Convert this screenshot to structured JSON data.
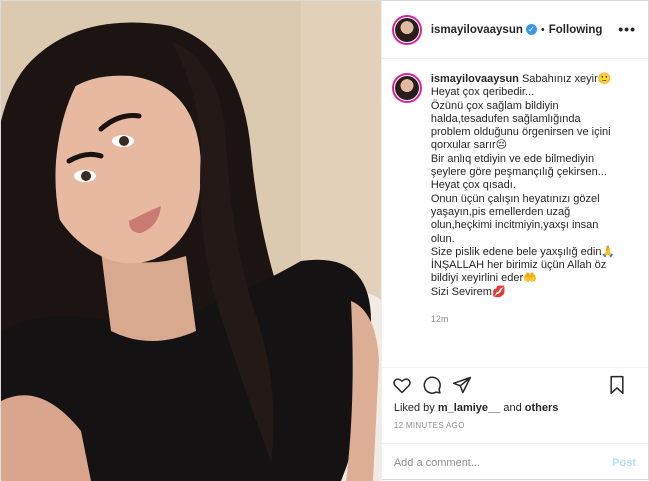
{
  "header": {
    "username": "ismayilovaaysun",
    "dot": "•",
    "following": "Following",
    "more": "•••"
  },
  "caption": {
    "username": "ismayilovaaysun",
    "first_line": "Sabahınız xeyir🙂",
    "lines": [
      "Heyat çox qeribedir...",
      "Özünü çox sağlam bildiyin",
      "halda,tesadufen sağlamlığında",
      "problem olduğunu örgenirsen ve içini",
      "qorxular sarır😔",
      "Bir anlıq etdiyin ve ede bilmediyin",
      "şeylere göre peşmançılığ çekirsen...",
      "Heyat çox qısadı.",
      "Onun üçün çalışın heyatınızı gözel",
      "yaşayın,pis emellerden uzağ",
      "olun,heçkimi incitmiyin,yaxşı insan",
      "olun.",
      "Size pislik edene bele yaxşılığ edin🙏",
      "İNŞALLAH her birimiz üçün Allah öz",
      "bildiyi xeyirlini eder🤲",
      "Sizi Sevirem💋"
    ],
    "time": "12m"
  },
  "likes": {
    "prefix": "Liked by",
    "user": "m_lamiye__",
    "and": "and",
    "others": "others"
  },
  "ago": "12 MINUTES AGO",
  "comment": {
    "placeholder": "Add a comment...",
    "post_label": "Post"
  },
  "colors": {
    "verified": "#3897f0",
    "post_disabled": "#b2dffc",
    "secondary_text": "#8e8e8e"
  }
}
